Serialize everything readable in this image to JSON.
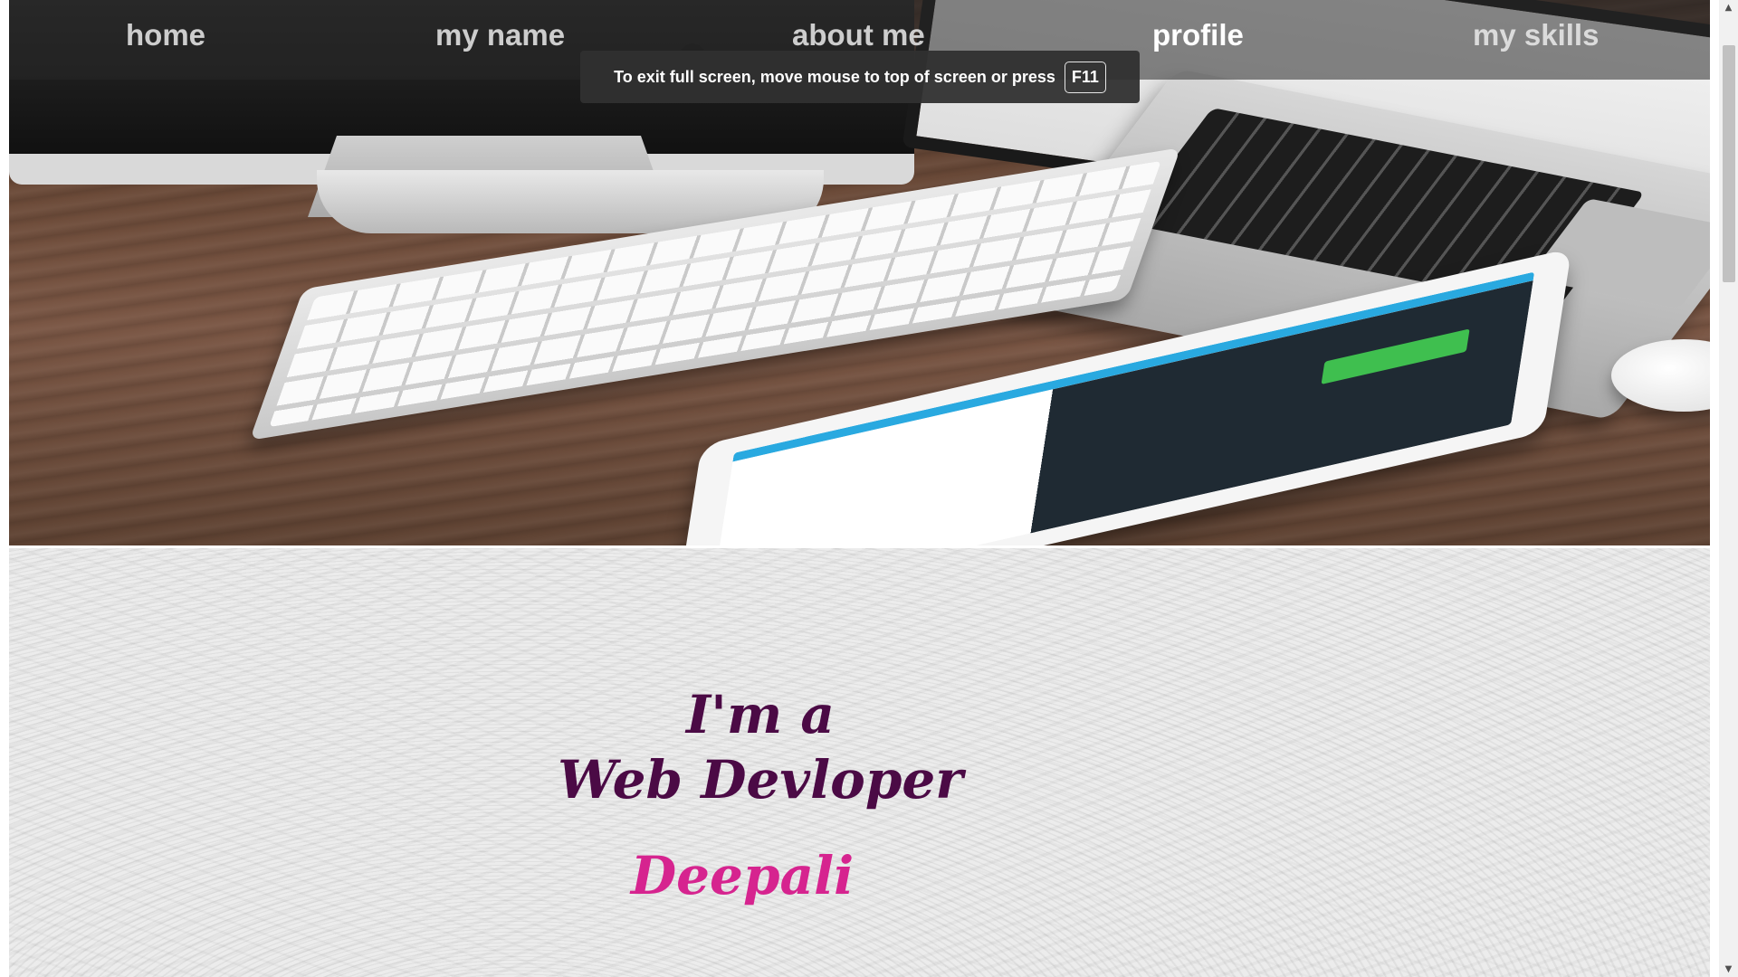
{
  "nav": {
    "items": [
      {
        "label": "home"
      },
      {
        "label": "my name"
      },
      {
        "label": "about me"
      },
      {
        "label": "profile"
      },
      {
        "label": "my skills"
      }
    ],
    "active": "profile"
  },
  "fullscreen_toast": {
    "message": "To exit full screen, move mouse to top of screen or press",
    "key": "F11"
  },
  "intro": {
    "line1": "I'm a",
    "line2": "Web Devloper",
    "name": "Deepali"
  },
  "colors": {
    "heading": "#4b0a45",
    "name": "#d6248f",
    "nav_bar": "#282828"
  },
  "icons": {
    "scroll_up": "triangle-up-icon",
    "scroll_down": "triangle-down-icon"
  }
}
